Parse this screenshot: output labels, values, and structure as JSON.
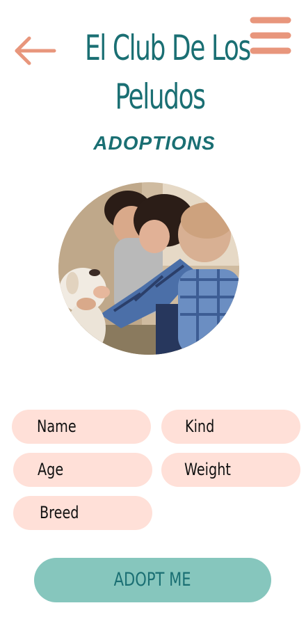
{
  "header": {
    "title_line1": "El Club De Los",
    "title_line2": "Peludos",
    "back_icon": "arrow-left-icon",
    "menu_icon": "hamburger-menu-icon"
  },
  "section": {
    "title": "ADOPTIONS"
  },
  "hero": {
    "image": "family-petting-dog-photo"
  },
  "form": {
    "name_placeholder": "Name",
    "kind_placeholder": "Kind",
    "age_placeholder": "Age",
    "weight_placeholder": "Weight",
    "breed_placeholder": "Breed"
  },
  "actions": {
    "adopt_label": "ADOPT ME"
  },
  "colors": {
    "primary": "#1a6f73",
    "accent": "#e8967c",
    "field_bg": "#ffe0d8",
    "button_bg": "#86c6bd"
  }
}
